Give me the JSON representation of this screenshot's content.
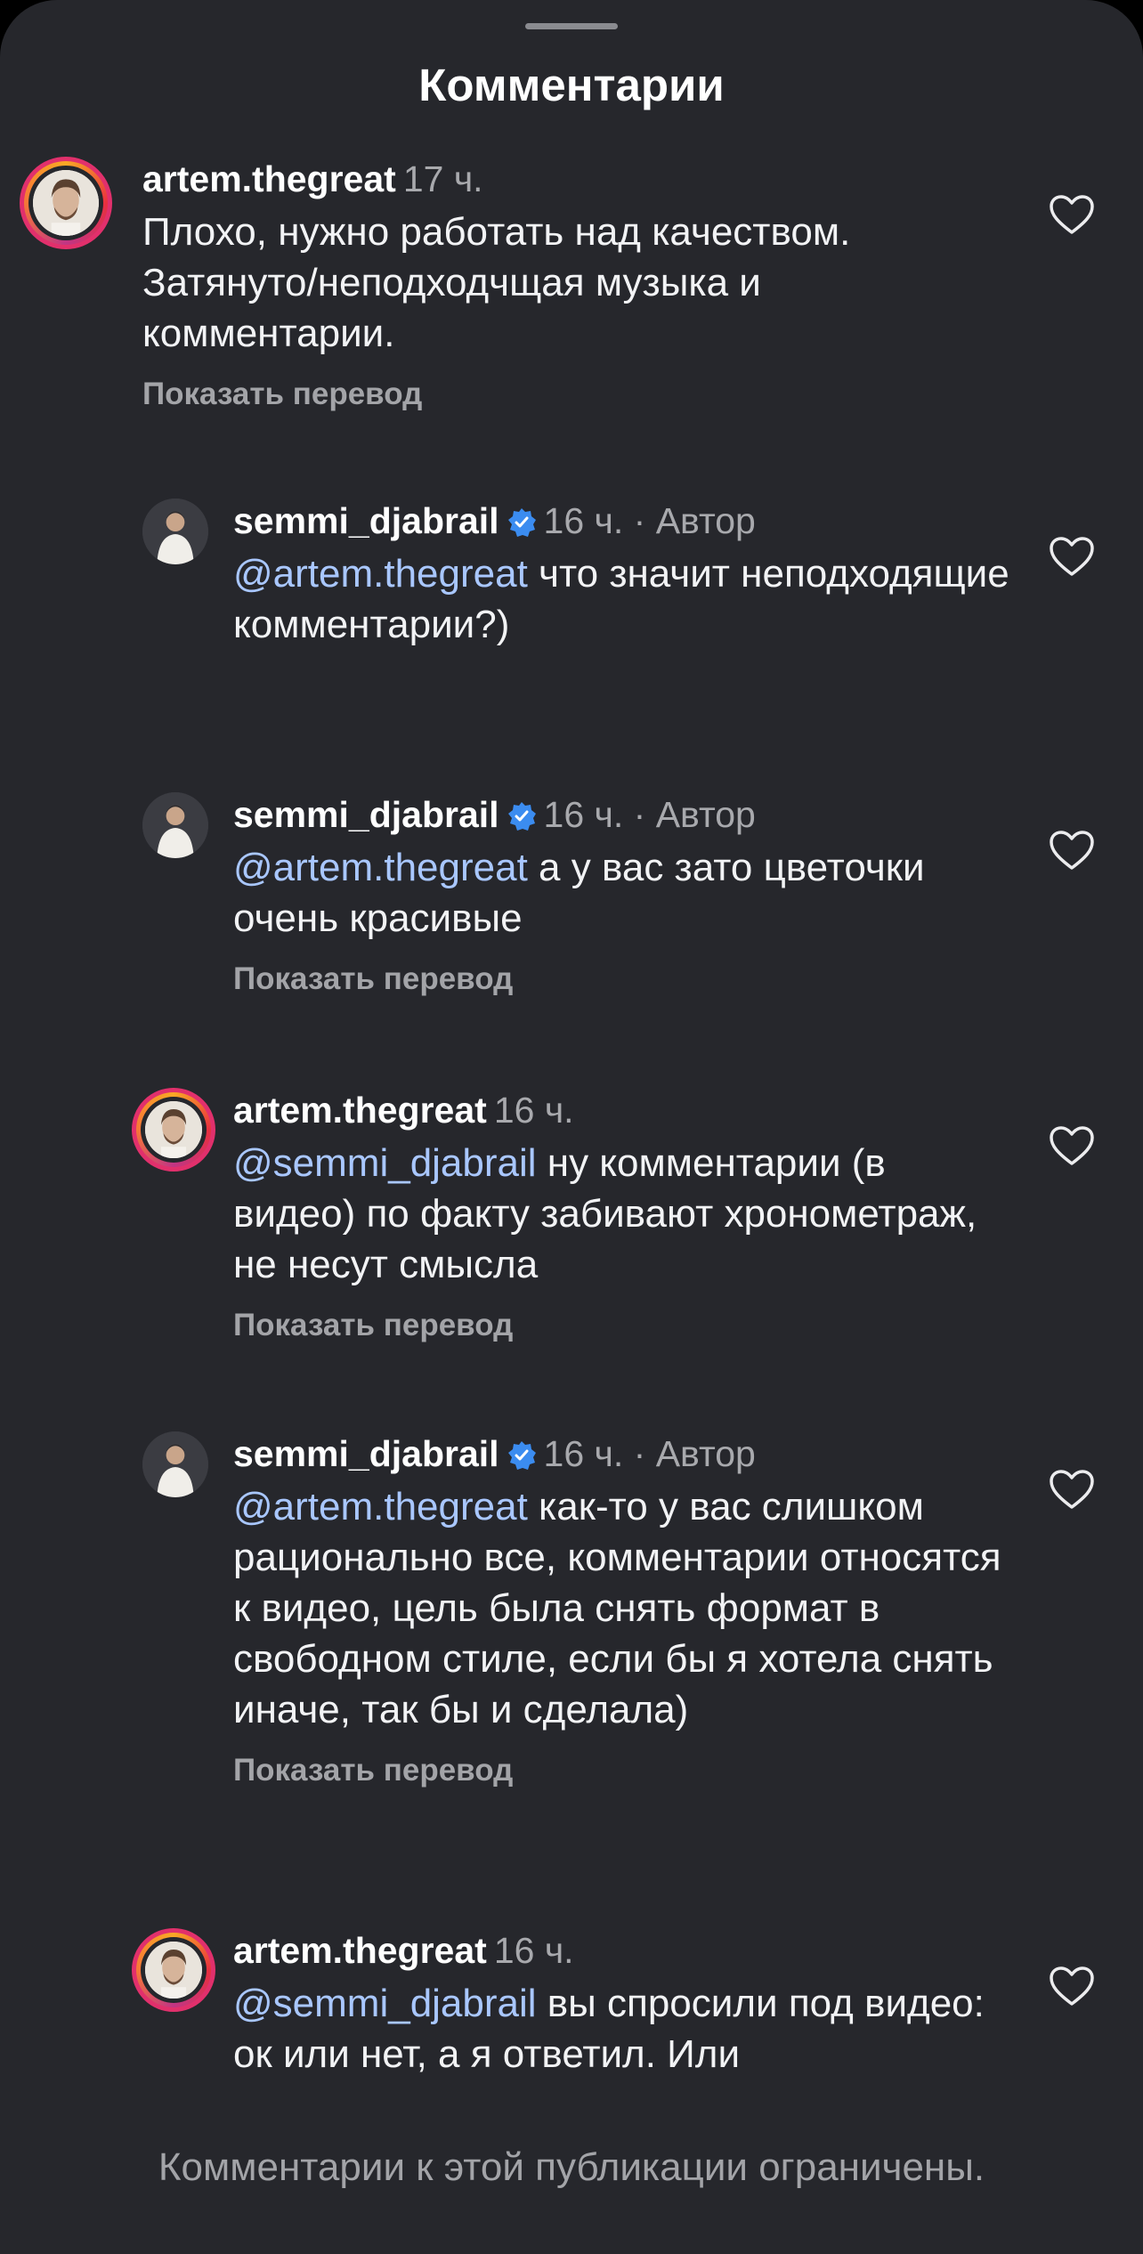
{
  "header": {
    "title": "Комментарии"
  },
  "comments": [
    {
      "username": "artem.thegreat",
      "time": "17 ч.",
      "mention": "",
      "text": "Плохо, нужно работать над качеством. Затянуто/неподходчщая музыка и комментарии.",
      "translate": "Показать перевод"
    },
    {
      "username": "semmi_djabrail",
      "time": "16 ч. · Автор",
      "mention": "@artem.thegreat",
      "text": " что значит неподходящие комментарии?)",
      "translate": ""
    },
    {
      "username": "semmi_djabrail",
      "time": "16 ч. · Автор",
      "mention": "@artem.thegreat",
      "text": " а у вас зато цветочки очень красивые",
      "translate": "Показать перевод"
    },
    {
      "username": "artem.thegreat",
      "time": "16 ч.",
      "mention": "@semmi_djabrail",
      "text": " ну комментарии (в видео) по факту забивают хронометраж, не несут смысла",
      "translate": "Показать перевод"
    },
    {
      "username": "semmi_djabrail",
      "time": "16 ч. · Автор",
      "mention": "@artem.thegreat",
      "text": " как-то у вас слишком рационально все, комментарии относятся к видео, цель была снять формат в свободном стиле, если бы я хотела снять иначе, так бы и сделала)",
      "translate": "Показать перевод"
    },
    {
      "username": "artem.thegreat",
      "time": "16 ч.",
      "mention": "@semmi_djabrail",
      "text": " вы спросили под видео: ок или нет, а я ответил. Или",
      "translate": ""
    }
  ],
  "footer": {
    "notice": "Комментарии к этой публикации ограничены."
  },
  "colors": {
    "background": "#26272c",
    "mention": "#a9c7ff",
    "verified": "#3b8cf0",
    "muted": "#a8a9ad"
  },
  "icons": {
    "like": "heart-outline-icon",
    "verified": "verified-badge-icon",
    "grabber": "sheet-grabber"
  }
}
